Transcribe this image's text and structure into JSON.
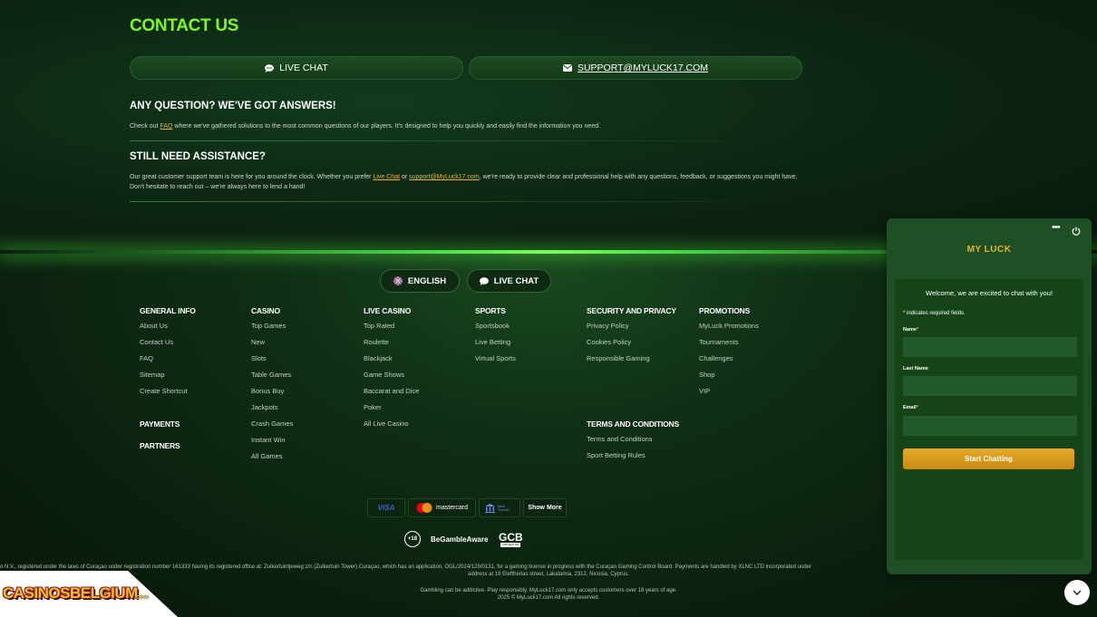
{
  "contact": {
    "title": "CONTACT US",
    "live_chat_label": "LIVE CHAT",
    "email_label": "SUPPORT@MYLUCK17.COM"
  },
  "faq": {
    "heading": "ANY QUESTION? WE'VE GOT ANSWERS!",
    "text_before": "Check out ",
    "link": "FAQ",
    "text_after": " where we've gathered solutions to the most common questions of our players. It's designed to help you quickly and easily find the information you need."
  },
  "assist": {
    "heading": "STILL NEED ASSISTANCE?",
    "text_1": "Our great customer support team is here for you around the clock. Whether you prefer ",
    "link_chat": "Live Chat",
    "text_2": " or ",
    "link_email": "support@MyLuck17.com",
    "text_3": ", we're ready to provide clear and professional help with any questions, feedback, or suggestions you might have. Don't hesitate to reach out – we're always here to lend a hand!"
  },
  "footer_buttons": {
    "language": "ENGLISH",
    "live_chat": "LIVE CHAT"
  },
  "footer": {
    "general": {
      "heading": "GENERAL INFO",
      "items": [
        "About Us",
        "Contact Us",
        "FAQ",
        "Sitemap",
        "Create Shortcut"
      ]
    },
    "casino": {
      "heading": "CASINO",
      "items": [
        "Top Games",
        "New",
        "Slots",
        "Table Games",
        "Bonus Buy",
        "Jackpots",
        "Crash Games",
        "Instant Win",
        "All Games"
      ]
    },
    "live_casino": {
      "heading": "LIVE CASINO",
      "items": [
        "Top Rated",
        "Roulette",
        "Blackjack",
        "Game Shows",
        "Baccarat and Dice",
        "Poker",
        "All Live Casino"
      ]
    },
    "sports": {
      "heading": "SPORTS",
      "items": [
        "Sportsbook",
        "Live Betting",
        "Virtual Sports"
      ]
    },
    "security": {
      "heading": "SECURITY AND PRIVACY",
      "items": [
        "Privacy Policy",
        "Cookies Policy",
        "Responsible Gaming"
      ]
    },
    "promotions": {
      "heading": "PROMOTIONS",
      "items": [
        "MyLuck Promotions",
        "Tournaments",
        "Challenges",
        "Shop",
        "VIP"
      ]
    },
    "terms": {
      "heading": "TERMS AND CONDITIONS",
      "items": [
        "Terms and Conditions",
        "Sport Betting Rules"
      ]
    },
    "payments": "PAYMENTS",
    "partners": "PARTNERS"
  },
  "payments": {
    "visa": "VISA",
    "mastercard": "mastercard",
    "bank": "Bank Transfer",
    "show_more": "Show More"
  },
  "responsible": {
    "age": "+18",
    "begamble": "BeGambleAware",
    "gcb": "GCB",
    "gcb_sub": "cert.gcb.cw"
  },
  "legal": {
    "line1": "o N.V., registered under the laws of Curaçao under registration number 161333 having its registered office at: Zuikertuintjeweg z/n (Zuikertuin Tower) Curaçao, which has an application, OGL/2024/129/0131, for a gaming license in progress with the Curaçao Gaming Control Board. Payments are handled by XLNC LTD incorporated under",
    "line2": "address at 19 Eleftherias street, Lakatamia, 2312, Nicosia, Cyprus.",
    "line3": "Gambling can be addictive. Play responsibly. MyLuck17.com only accepts customers over 18 years of age.",
    "line4": "2025 © MyLuck17.com All rights reserved."
  },
  "watermark": {
    "text": "CASINOSBELGIUM",
    "suffix": ".com"
  },
  "chat": {
    "menu_icon": "more-horizontal-icon",
    "power_icon": "power-icon",
    "brand": "MY LUCK",
    "welcome": "Welcome, we are excited to chat with you!",
    "required_note": "* indicates required fields.",
    "name_label": "Name",
    "lastname_label": "Last Name",
    "email_label": "Email",
    "start_button": "Start Chatting"
  },
  "colors": {
    "accent_green": "#7cfa1a",
    "link_orange": "#f0b21e",
    "button_gold": "#d99b1e"
  }
}
